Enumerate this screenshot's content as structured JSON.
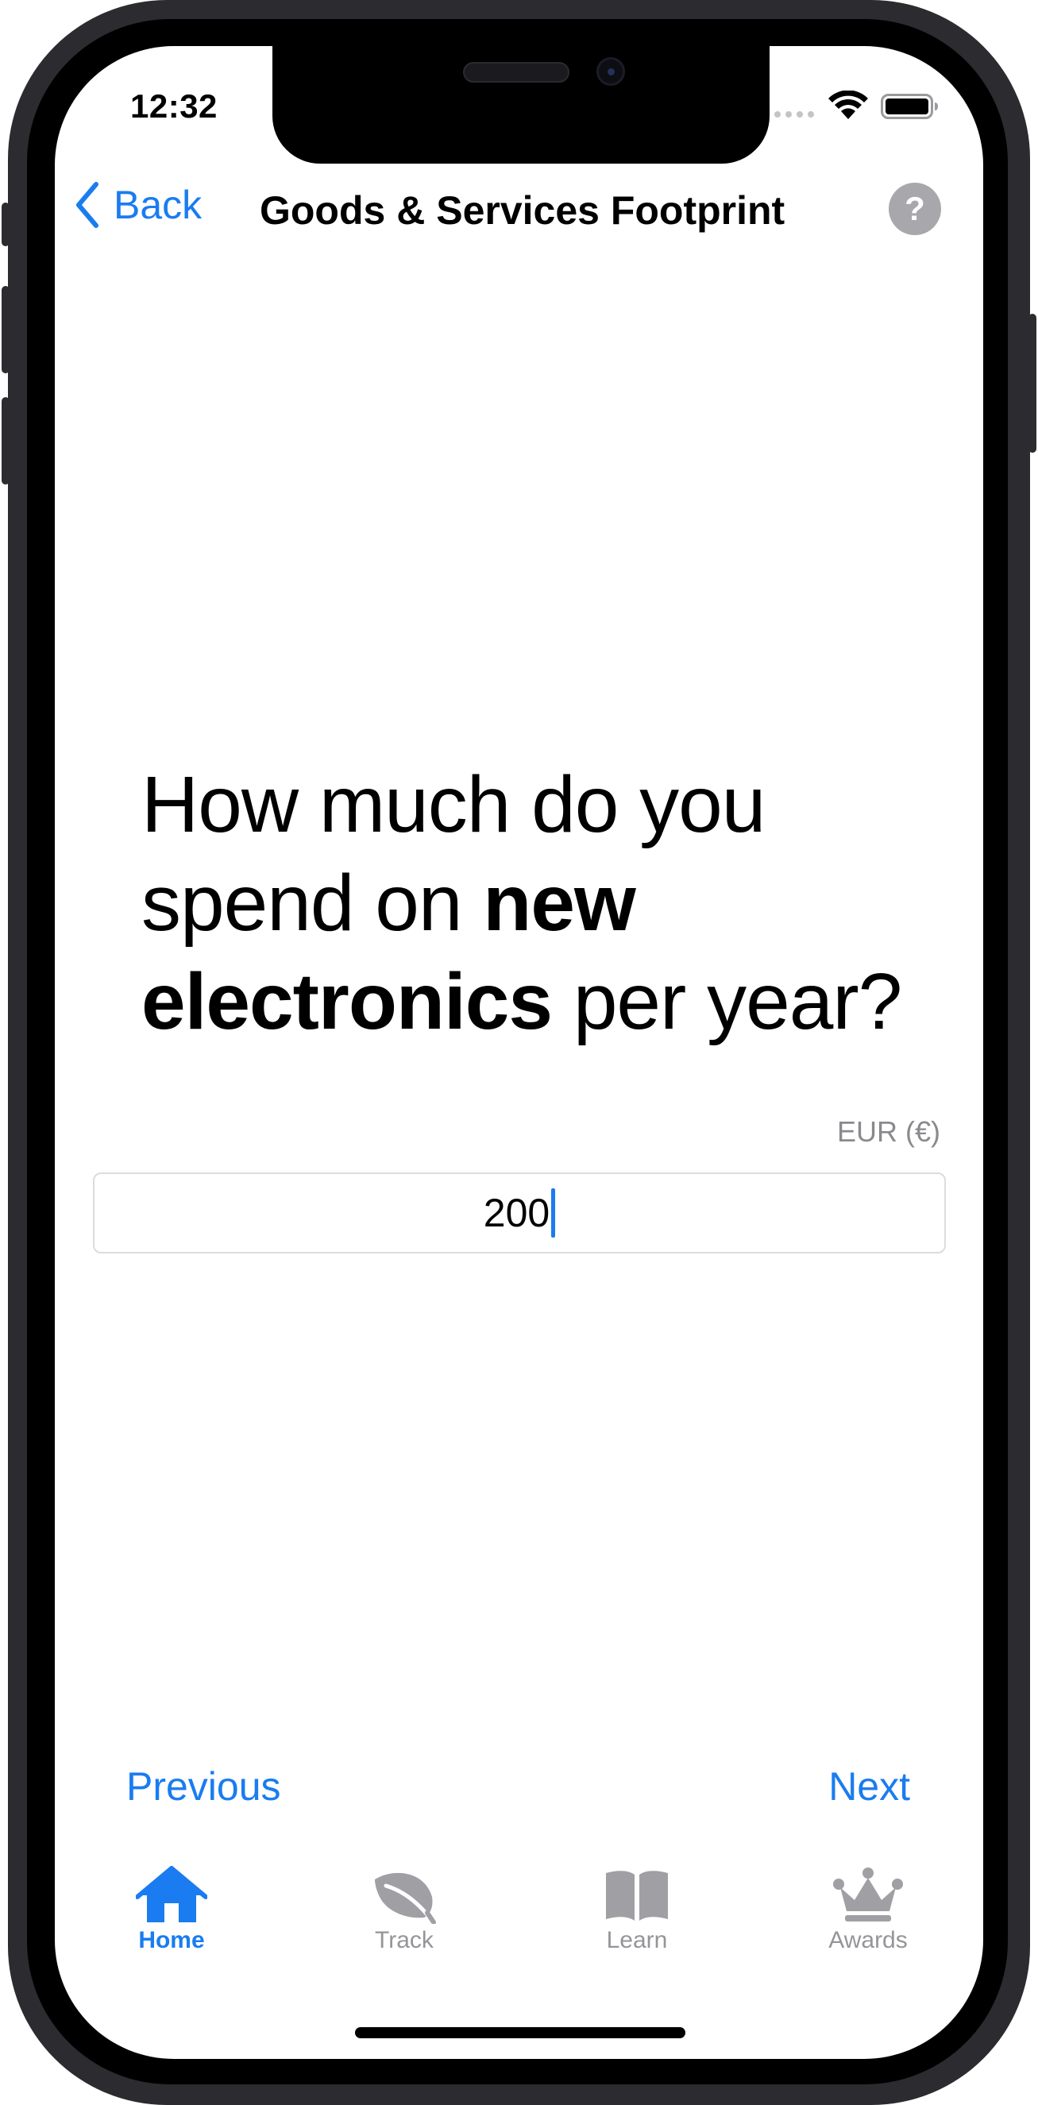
{
  "status_bar": {
    "time": "12:32"
  },
  "nav": {
    "back_label": "Back",
    "title": "Goods & Services Footprint",
    "help_label": "?"
  },
  "question": {
    "part1": "How much do you spend on ",
    "emphasis": "new electronics",
    "part2": " per year?"
  },
  "amount": {
    "currency_label": "EUR (€)",
    "value": "200"
  },
  "pager": {
    "previous_label": "Previous",
    "next_label": "Next"
  },
  "tab_bar": {
    "tabs": [
      {
        "label": "Home",
        "icon": "house-icon",
        "active": true
      },
      {
        "label": "Track",
        "icon": "leaf-icon",
        "active": false
      },
      {
        "label": "Learn",
        "icon": "book-icon",
        "active": false
      },
      {
        "label": "Awards",
        "icon": "crown-icon",
        "active": false
      }
    ]
  },
  "colors": {
    "accent": "#1a7cf0",
    "inactive_tab": "#959599",
    "help_button": "#a7a7ac"
  }
}
